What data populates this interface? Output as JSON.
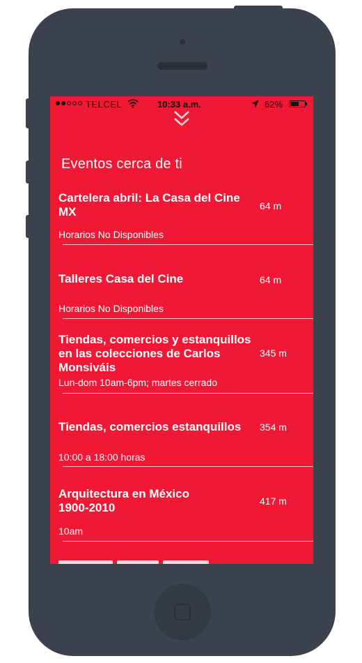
{
  "status_bar": {
    "signal_filled": 2,
    "signal_total": 5,
    "carrier": "TELCEL",
    "time": "10:33 a.m.",
    "battery": "62%",
    "battery_level": 0.62
  },
  "section_title": "Eventos cerca de ti",
  "events": [
    {
      "title": "Cartelera abril: La Casa del Cine MX",
      "distance": "64 m",
      "schedule": "Horarios No Disponibles"
    },
    {
      "title": "Talleres Casa del Cine",
      "distance": "64 m",
      "schedule": "Horarios No Disponibles"
    },
    {
      "title": "Tiendas, comercios y estanquillos en las colecciones de Carlos Monsiváis",
      "distance": "345 m",
      "schedule": "Lun-dom 10am-6pm; martes cerrado"
    },
    {
      "title": "Tiendas, comercios estanquillos",
      "distance": "354 m",
      "schedule": "10:00 a 18:00 horas"
    },
    {
      "title": "Arquitectura en México 1900-2010",
      "distance": "417 m",
      "schedule": "10am"
    }
  ],
  "colors": {
    "screen_bg": "#f01835",
    "phone_body": "#3b424d",
    "text": "#ffffff"
  }
}
